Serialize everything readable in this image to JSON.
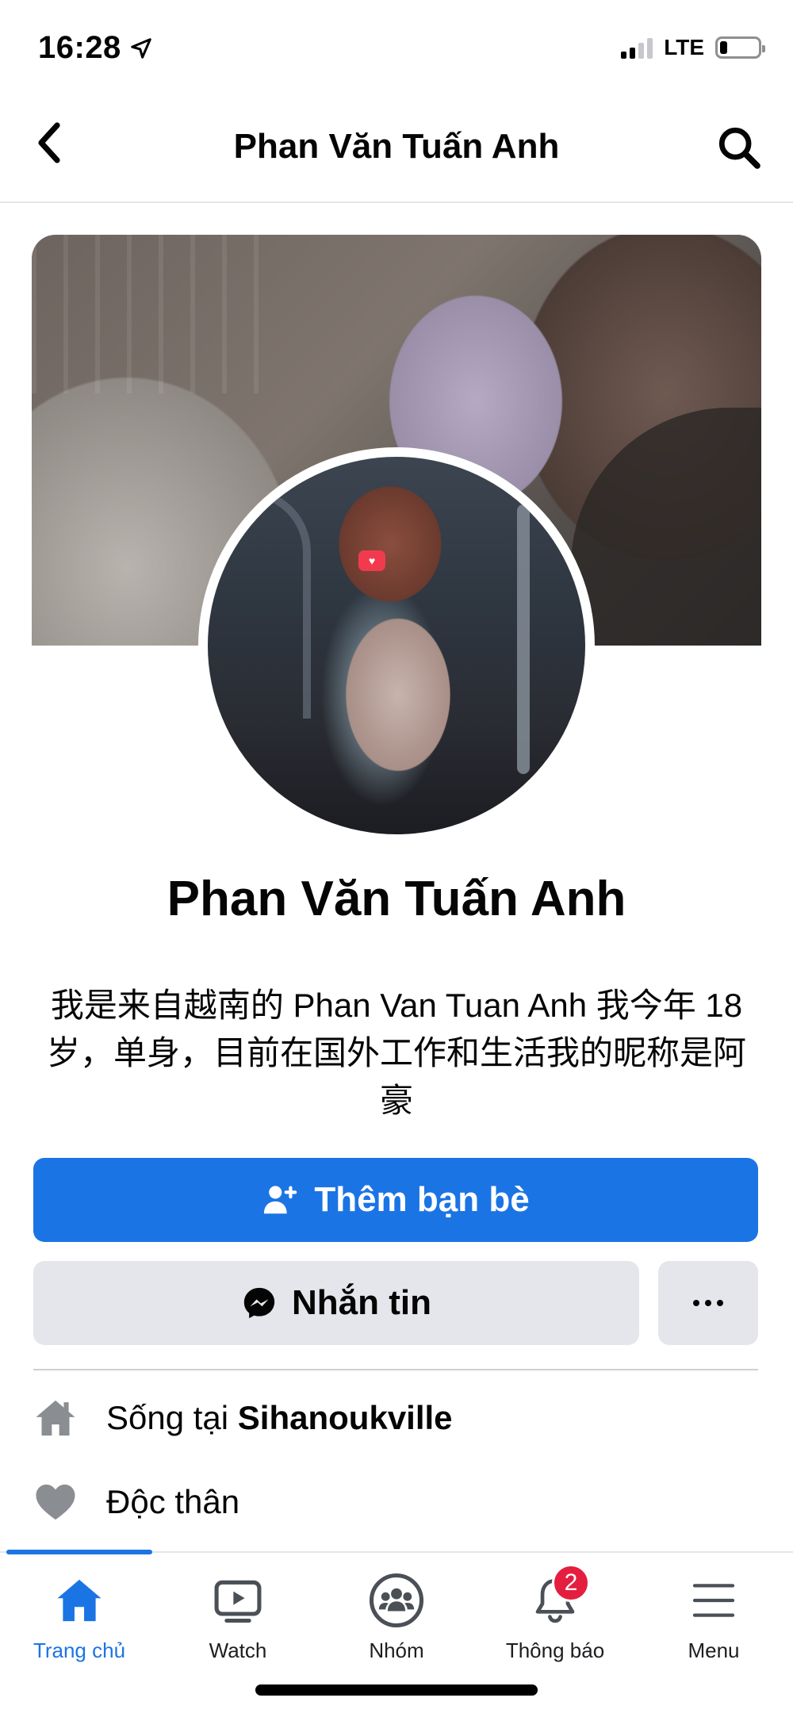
{
  "status_bar": {
    "time": "16:28",
    "network": "LTE",
    "location_icon": "location-arrow-icon",
    "signal_icon": "signal-bars-icon",
    "battery_icon": "battery-icon",
    "battery_level": 0.2
  },
  "header": {
    "title": "Phan Văn Tuấn Anh",
    "back_icon": "chevron-left-icon",
    "search_icon": "search-icon"
  },
  "profile": {
    "name": "Phan Văn Tuấn Anh",
    "bio": "我是来自越南的 Phan Van Tuan Anh 我今年 18 岁，单身，目前在国外工作和生活我的昵称是阿豪"
  },
  "actions": {
    "add_friend_label": "Thêm bạn bè",
    "add_friend_icon": "add-friend-icon",
    "message_label": "Nhắn tin",
    "message_icon": "messenger-icon",
    "more_icon": "more-dots-icon"
  },
  "info": {
    "lives_prefix": "Sống tại",
    "lives_place": "Sihanoukville",
    "lives_icon": "house-icon",
    "relationship": "Độc thân",
    "relationship_icon": "heart-icon"
  },
  "tab_bar": {
    "tabs": [
      {
        "label": "Trang chủ",
        "icon": "home-icon",
        "active": true
      },
      {
        "label": "Watch",
        "icon": "video-play-icon",
        "active": false
      },
      {
        "label": "Nhóm",
        "icon": "groups-icon",
        "active": false
      },
      {
        "label": "Thông báo",
        "icon": "bell-icon",
        "active": false,
        "badge": "2"
      },
      {
        "label": "Menu",
        "icon": "hamburger-icon",
        "active": false
      }
    ]
  },
  "colors": {
    "accent": "#1b74e4",
    "button_gray": "#e4e6eb",
    "badge_red": "#e41e3f",
    "icon_gray": "#65676b"
  }
}
